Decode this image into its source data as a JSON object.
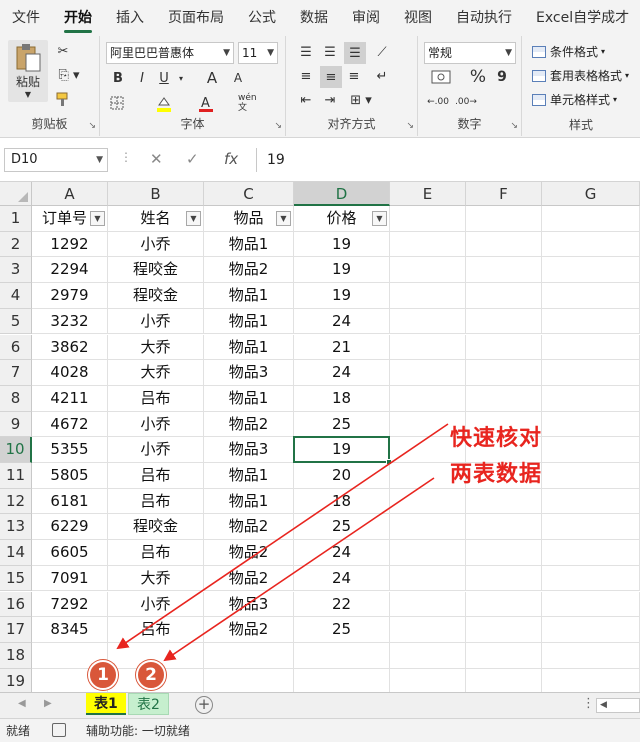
{
  "menu": [
    "文件",
    "开始",
    "插入",
    "页面布局",
    "公式",
    "数据",
    "审阅",
    "视图",
    "自动执行",
    "Excel自学成才"
  ],
  "active_menu_index": 1,
  "ribbon": {
    "clipboard": {
      "paste_label": "粘贴",
      "group_label": "剪贴板"
    },
    "font": {
      "font_name": "阿里巴巴普惠体",
      "font_size": "11",
      "group_label": "字体",
      "bold": "B",
      "italic": "I",
      "underline": "U",
      "grow": "A",
      "shrink": "A",
      "pinyin": "wén 文"
    },
    "alignment": {
      "group_label": "对齐方式"
    },
    "number": {
      "format": "常规",
      "group_label": "数字",
      "percent": "%",
      "comma": "9"
    },
    "styles": {
      "conditional": "条件格式",
      "table_format": "套用表格格式",
      "cell_styles": "单元格样式",
      "group_label": "样式"
    }
  },
  "formula_bar": {
    "name_box": "D10",
    "formula": "19",
    "fx": "fx"
  },
  "grid": {
    "columns": [
      "A",
      "B",
      "C",
      "D",
      "E",
      "F",
      "G"
    ],
    "selected_column": "D",
    "selected_row": 10,
    "row_numbers": [
      "1",
      "2",
      "3",
      "4",
      "5",
      "6",
      "7",
      "8",
      "9",
      "10",
      "11",
      "12",
      "13",
      "14",
      "15",
      "16",
      "17",
      "18",
      "19"
    ],
    "headers": [
      "订单号",
      "姓名",
      "物品",
      "价格"
    ],
    "rows": [
      [
        "1292",
        "小乔",
        "物品1",
        "19"
      ],
      [
        "2294",
        "程咬金",
        "物品2",
        "19"
      ],
      [
        "2979",
        "程咬金",
        "物品1",
        "19"
      ],
      [
        "3232",
        "小乔",
        "物品1",
        "24"
      ],
      [
        "3862",
        "大乔",
        "物品1",
        "21"
      ],
      [
        "4028",
        "大乔",
        "物品3",
        "24"
      ],
      [
        "4211",
        "吕布",
        "物品1",
        "18"
      ],
      [
        "4672",
        "小乔",
        "物品2",
        "25"
      ],
      [
        "5355",
        "小乔",
        "物品3",
        "19"
      ],
      [
        "5805",
        "吕布",
        "物品1",
        "20"
      ],
      [
        "6181",
        "吕布",
        "物品1",
        "18"
      ],
      [
        "6229",
        "程咬金",
        "物品2",
        "25"
      ],
      [
        "6605",
        "吕布",
        "物品2",
        "24"
      ],
      [
        "7091",
        "大乔",
        "物品2",
        "24"
      ],
      [
        "7292",
        "小乔",
        "物品3",
        "22"
      ],
      [
        "8345",
        "吕布",
        "物品2",
        "25"
      ]
    ]
  },
  "annotation": {
    "line1": "快速核对",
    "line2": "两表数据",
    "color": "#e8251f"
  },
  "badges": [
    "1",
    "2"
  ],
  "sheets": [
    "表1",
    "表2"
  ],
  "status": {
    "ready": "就绪",
    "accessibility": "辅助功能: 一切就绪"
  },
  "colors": {
    "accent": "#217346",
    "tab1_bg": "#ffff00",
    "tab2_bg": "#c6efce",
    "badge": "#d9573a"
  }
}
